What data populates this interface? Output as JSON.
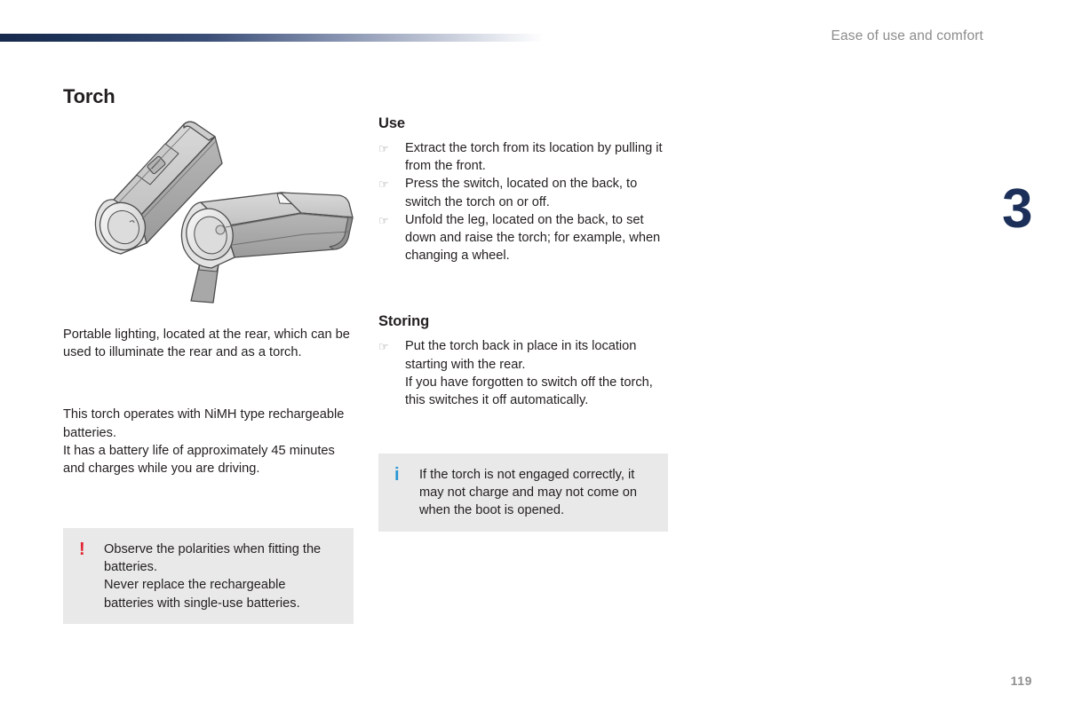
{
  "header": {
    "section_title": "Ease of use and comfort",
    "rule_color_start": "#17294d",
    "rule_color_end": "#ffffff"
  },
  "chapter": {
    "number": "3",
    "color": "#1c2f58"
  },
  "footer": {
    "page_number": "119",
    "color": "#8f8f8f"
  },
  "page": {
    "title": "Torch"
  },
  "illustration": {
    "name": "torch-illustration",
    "caption": "Two portable torches shown at an angle: one with the switch on the back, one with the support leg unfolded"
  },
  "left_column": {
    "intro_paragraph": "Portable lighting, located at the rear, which can be used to illuminate the rear and as a torch.",
    "battery_paragraph_line1": "This torch operates with NiMH type rechargeable batteries.",
    "battery_paragraph_line2": "It has a battery life of approximately 45 minutes and charges while you are driving."
  },
  "right_column": {
    "use": {
      "heading": "Use",
      "items": [
        "Extract the torch from its location by pulling it from the front.",
        "Press the switch, located on the back, to switch the torch on or off.",
        "Unfold the leg, located on the back, to set down and raise the torch; for example, when changing a wheel."
      ]
    },
    "storing": {
      "heading": "Storing",
      "items": [
        "Put the torch back in place in its location starting with the rear."
      ],
      "continuation": "If you have forgotten to switch off the torch, this switches it off automatically."
    }
  },
  "callouts": {
    "warning": {
      "glyph": "!",
      "glyph_name": "warning-exclamation-icon",
      "glyph_color": "#e1222f",
      "background": "#e9e9e9",
      "line1": "Observe the polarities when fitting the batteries.",
      "line2": "Never replace the rechargeable batteries with single-use batteries."
    },
    "info": {
      "glyph": "i",
      "glyph_name": "information-icon",
      "glyph_color": "#2b97d4",
      "background": "#e9e9e9",
      "text": "If the torch is not engaged correctly, it may not charge and may not come on when the boot is opened."
    }
  },
  "bullet": {
    "glyph": "☞",
    "glyph_name": "pointing-hand-icon"
  }
}
